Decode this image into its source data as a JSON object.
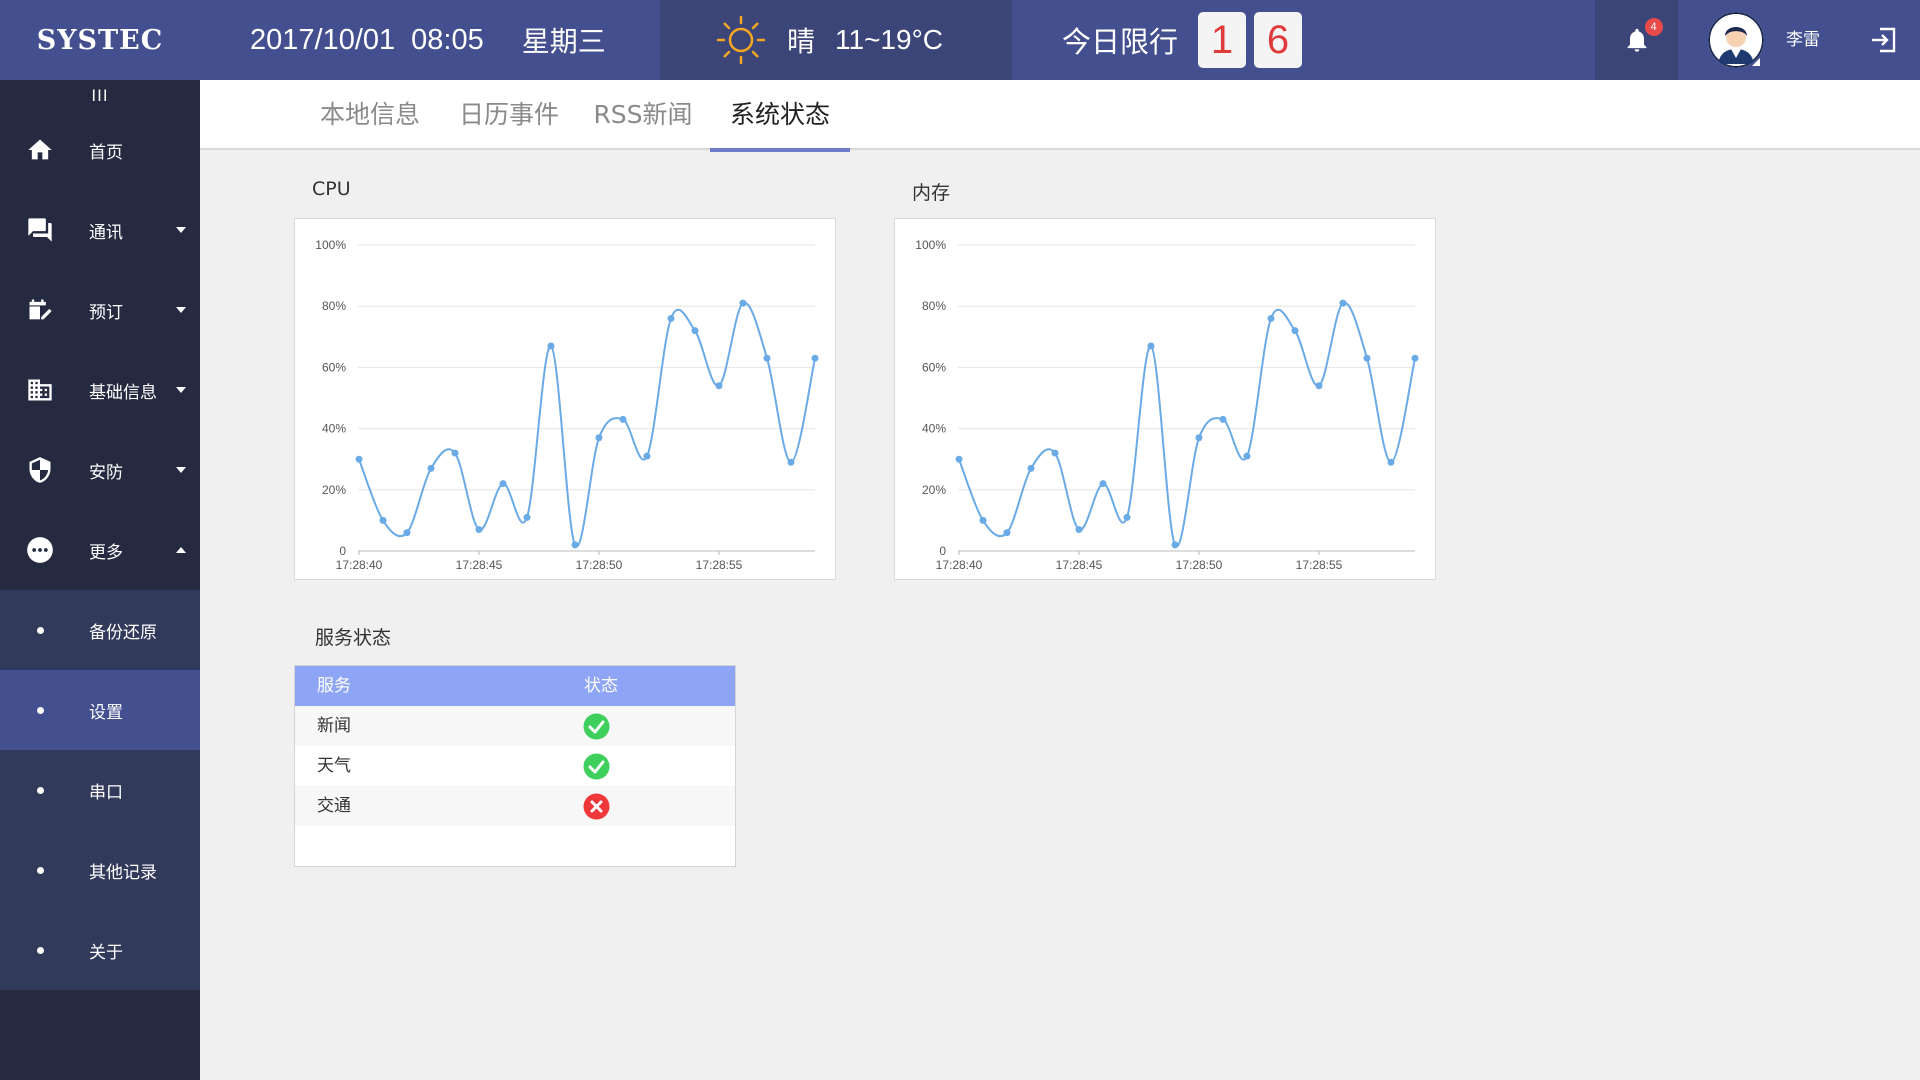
{
  "header": {
    "logo": "SYSTEC",
    "date": "2017/10/01",
    "time": "08:05",
    "weekday": "星期三",
    "weather": {
      "icon": "sun-icon",
      "condition": "晴",
      "temp": "11~19°C"
    },
    "limit": {
      "label": "今日限行",
      "digits": [
        "1",
        "6"
      ]
    },
    "notifications": 4,
    "user": "李雷"
  },
  "sidebar": {
    "collapse_glyph": "III",
    "items": [
      {
        "label": "首页",
        "icon": "home-icon",
        "arrow": ""
      },
      {
        "label": "通讯",
        "icon": "chat-icon",
        "arrow": "down"
      },
      {
        "label": "预订",
        "icon": "booking-icon",
        "arrow": "down"
      },
      {
        "label": "基础信息",
        "icon": "building-icon",
        "arrow": "down"
      },
      {
        "label": "安防",
        "icon": "shield-icon",
        "arrow": "down"
      },
      {
        "label": "更多",
        "icon": "more-icon",
        "arrow": "up"
      }
    ],
    "subitems": [
      {
        "label": "备份还原",
        "active": false
      },
      {
        "label": "设置",
        "active": true
      },
      {
        "label": "串口",
        "active": false
      },
      {
        "label": "其他记录",
        "active": false
      },
      {
        "label": "关于",
        "active": false
      }
    ]
  },
  "tabs": [
    {
      "label": "本地信息",
      "active": false
    },
    {
      "label": "日历事件",
      "active": false
    },
    {
      "label": "RSS新闻",
      "active": false
    },
    {
      "label": "系统状态",
      "active": true
    }
  ],
  "chart_data": [
    {
      "type": "line",
      "title": "CPU",
      "x_ticks": [
        "17:28:40",
        "17:28:45",
        "17:28:50",
        "17:28:55"
      ],
      "y_ticks": [
        "0",
        "20%",
        "40%",
        "60%",
        "80%",
        "100%"
      ],
      "ylim": [
        0,
        100
      ],
      "grid": true,
      "series": [
        {
          "values": [
            30,
            10,
            6,
            27,
            32,
            7,
            22,
            11,
            67,
            2,
            37,
            43,
            31,
            76,
            72,
            54,
            81,
            63,
            29,
            63
          ]
        }
      ],
      "color": "#6aaae6"
    },
    {
      "type": "line",
      "title": "内存",
      "x_ticks": [
        "17:28:40",
        "17:28:45",
        "17:28:50",
        "17:28:55"
      ],
      "y_ticks": [
        "0",
        "20%",
        "40%",
        "60%",
        "80%",
        "100%"
      ],
      "ylim": [
        0,
        100
      ],
      "grid": true,
      "series": [
        {
          "values": [
            30,
            10,
            6,
            27,
            32,
            7,
            22,
            11,
            67,
            2,
            37,
            43,
            31,
            76,
            72,
            54,
            81,
            63,
            29,
            63
          ]
        }
      ],
      "color": "#6aaae6"
    }
  ],
  "services": {
    "title": "服务状态",
    "headers": [
      "服务",
      "状态"
    ],
    "rows": [
      {
        "name": "新闻",
        "ok": true
      },
      {
        "name": "天气",
        "ok": true
      },
      {
        "name": "交通",
        "ok": false
      }
    ],
    "ok_color": "#3ecf5c",
    "fail_color": "#f0383a"
  }
}
